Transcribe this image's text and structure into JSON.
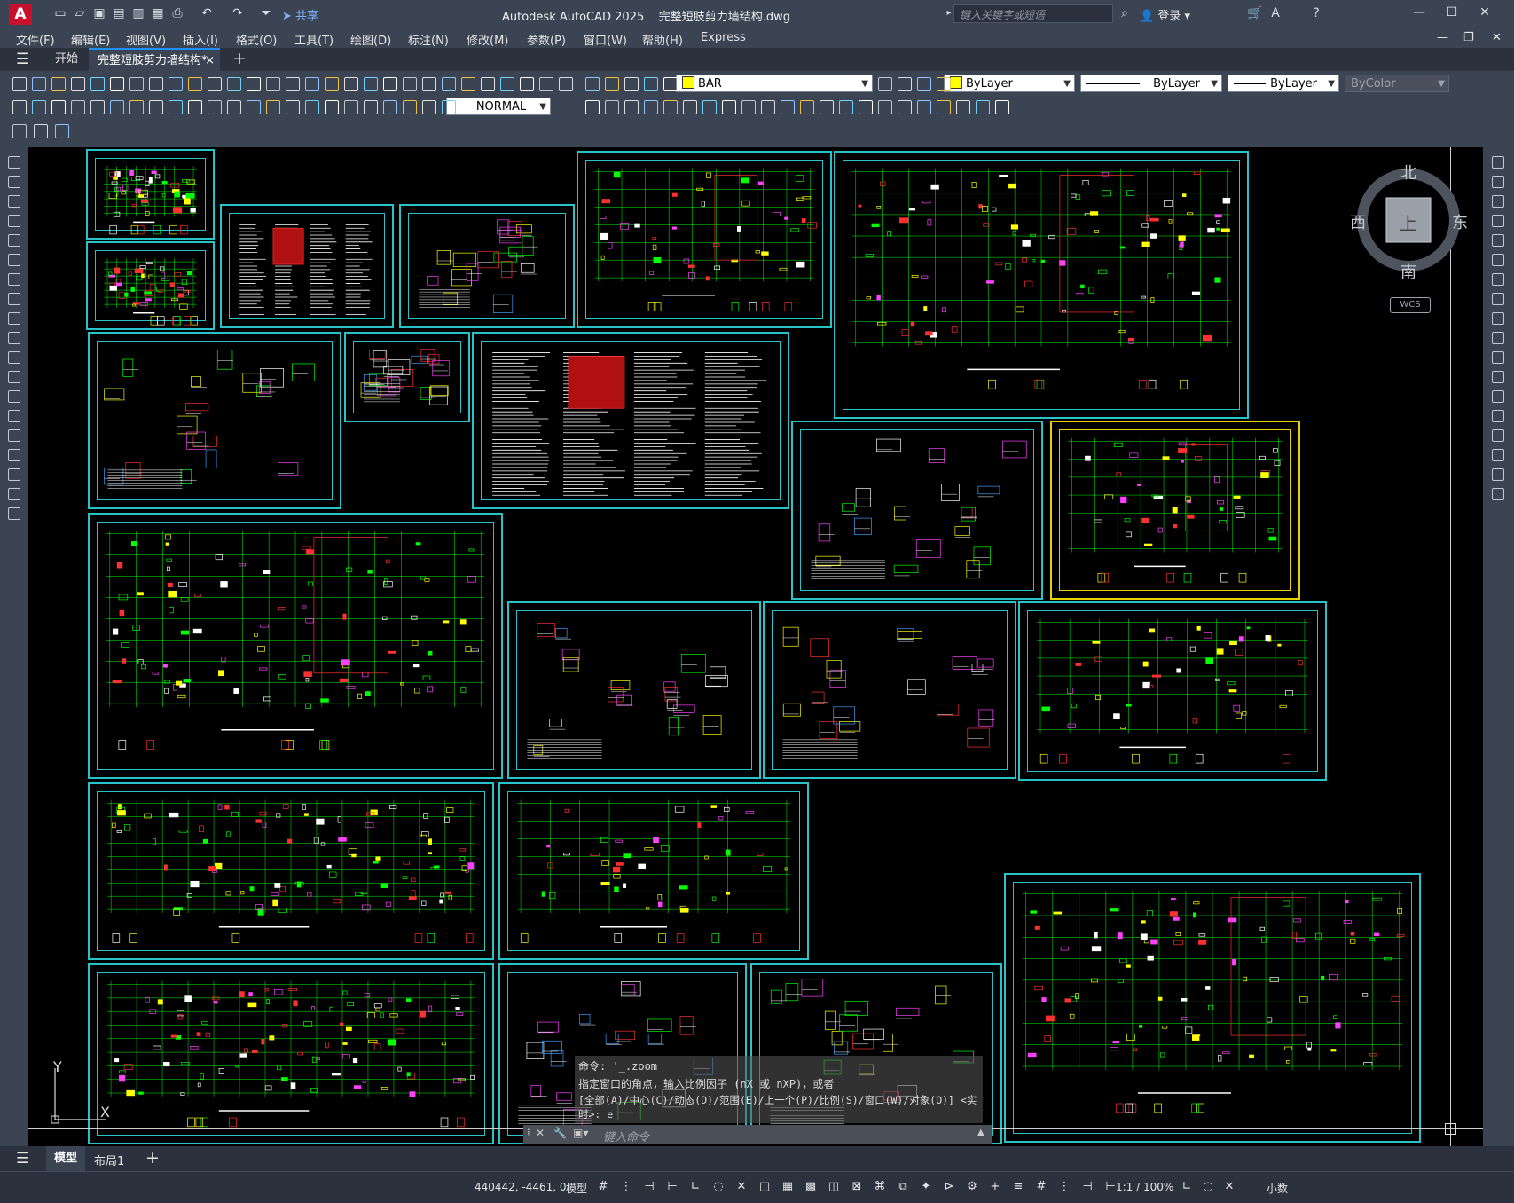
{
  "titlebar": {
    "logo": "A",
    "share": "共享",
    "app_title": "Autodesk AutoCAD 2025",
    "file_name": "完整短肢剪力墙结构.dwg",
    "search_placeholder": "键入关键字或短语",
    "login": "登录",
    "icons": [
      "new-icon",
      "open-icon",
      "save-icon",
      "saveas-icon",
      "publish-icon",
      "plot-icon",
      "undo-icon",
      "redo-icon"
    ]
  },
  "menu": [
    "文件(F)",
    "编辑(E)",
    "视图(V)",
    "插入(I)",
    "格式(O)",
    "工具(T)",
    "绘图(D)",
    "标注(N)",
    "修改(M)",
    "参数(P)",
    "窗口(W)",
    "帮助(H)",
    "Express"
  ],
  "tabs": {
    "start": "开始",
    "drawing": "完整短肢剪力墙结构*",
    "close": "×",
    "add": "+"
  },
  "properties": {
    "layer": "BAR",
    "layer_color": "#ffff00",
    "color": "ByLayer",
    "color_swatch": "#ffff00",
    "linetype": "ByLayer",
    "lineweight": "ByLayer",
    "plotstyle": "ByColor",
    "dimstyle": "NORMAL"
  },
  "viewcube": {
    "north": "北",
    "south": "南",
    "east": "东",
    "west": "西",
    "face": "上",
    "wcs": "WCS"
  },
  "ucs": {
    "y": "Y",
    "x": "X"
  },
  "command": {
    "line1": "命令: '_.zoom",
    "line2": "指定窗口的角点，输入比例因子 (nX 或 nXP)，或者",
    "line3": "[全部(A)/中心(C)/动态(D)/范围(E)/上一个(P)/比例(S)/窗口(W)/对象(O)] <实时>: e",
    "input_placeholder": "键入命令"
  },
  "layouts": {
    "model": "模型",
    "layout1": "布局1",
    "add": "+"
  },
  "status": {
    "coords": "440442, -4461, 0",
    "model": "模型",
    "scale": "1:1 / 100%",
    "units": "小数"
  },
  "colors": {
    "sheet_border": "#27c3c9",
    "canvas": "#000000",
    "ui": "#3b4453"
  }
}
